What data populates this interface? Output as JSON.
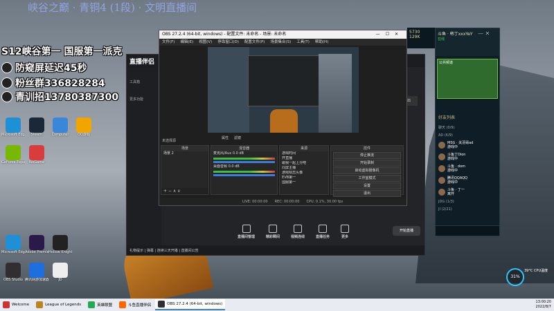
{
  "banner_text": "峡谷之巅 · 青铜4 (1段) · 文明直播间",
  "overlay": {
    "line1": "S12峡谷第一 国服第一派克",
    "line2": "防窥屏延迟45秒",
    "line3": "粉丝群336828284",
    "line4": "青训招13780387300"
  },
  "desktop_icons": [
    {
      "label": "Microsoft Edge",
      "color": "#1f8fd6"
    },
    {
      "label": "Steam",
      "color": "#1b2838"
    },
    {
      "label": "Computer",
      "color": "#3a86d9"
    },
    {
      "label": "QQ游戏",
      "color": "#f0a500"
    },
    {
      "label": "GeForce Experience",
      "color": "#76b900"
    },
    {
      "label": "WeGame",
      "color": "#d93c3c"
    },
    {
      "label": "Microsoft Edge",
      "color": "#1f8fd6"
    },
    {
      "label": "Adobe Premiere",
      "color": "#2a1a4a"
    },
    {
      "label": "Hollow Knight",
      "color": "#222"
    },
    {
      "label": "OBS Studio",
      "color": "#302e31"
    },
    {
      "label": "腾讯网游加速器",
      "color": "#1e6ee0"
    },
    {
      "label": "JD",
      "color": "#eee"
    }
  ],
  "obs": {
    "title": "OBS 27.2.4 (64-bit, windows) - 配置文件: 未命名 - 场景: 未命名",
    "menu": [
      "文件(F)",
      "编辑(E)",
      "视图(V)",
      "停靠窗口(D)",
      "配置文件(P)",
      "场景集合(S)",
      "工具(T)",
      "帮助(H)"
    ],
    "no_source": "未选择源",
    "controls": [
      "属性",
      "滤镜"
    ],
    "scenes_header": "场景",
    "scenes": [
      "场景 2"
    ],
    "mixer_header": "混音器",
    "mixer": [
      {
        "name": "麦克风/Aux",
        "level": "0.0 dB"
      },
      {
        "name": "桌面音频",
        "level": "0.0 dB"
      }
    ],
    "sources_header": "来源",
    "sources": [
      "游戏时间",
      "开直播",
      "跟我一起上分吧",
      "同屏主播",
      "游戏标志头像",
      "EVB第一",
      "国服第一"
    ],
    "controls_header": "控件",
    "control_buttons": [
      "停止推流",
      "开始录制",
      "启动虚拟摄像机",
      "工作室模式",
      "设置",
      "退出"
    ],
    "status": [
      "LIVE: 00:00:00",
      "REC: 00:00:00",
      "CPU: 0.1%, 30.00 fps"
    ]
  },
  "live_app": {
    "logo": "直播伴侣",
    "side_items": [
      "工具箱",
      "更多功能"
    ],
    "bottom_items": [
      "直播间管理",
      "精彩瞬间",
      "视频连线",
      "直播任务",
      "更多"
    ],
    "start_button": "开始直播",
    "right_button": "退出",
    "footer": "礼物提示  |  弹幕  |  连续三天开播  |  直播间公告"
  },
  "lol": {
    "rp": "5730",
    "be": "129K",
    "player_name": "斗鱼 · 韩丁xxxYeY",
    "player_status": "在线",
    "party_text": "公共频道",
    "friends_header": "好友列表",
    "groups": [
      "聊天 (0/9)",
      "AD (6/9)",
      "JDG (1/3)",
      "JI (2/21)"
    ],
    "friends": [
      {
        "name": "MSG · 关羽哥ad",
        "status": "游戏中"
      },
      {
        "name": "斗鱼丁Dion",
        "status": "游戏中"
      },
      {
        "name": "斗鱼 · dom",
        "status": "游戏中"
      },
      {
        "name": "腾讯QQAQQ",
        "status": "游戏中"
      },
      {
        "name": "斗鱼 · 丁一",
        "status": "离开"
      }
    ]
  },
  "system": {
    "battery": "31%",
    "cpu": "39°C CPU温度",
    "time": "13:00:20",
    "date": "2022/8/7"
  },
  "taskbar": [
    {
      "label": "Welcome",
      "color": "#c33",
      "active": false
    },
    {
      "label": "League of Legends",
      "color": "#b8861d",
      "active": false
    },
    {
      "label": "英雄联盟",
      "color": "#2a5",
      "active": false
    },
    {
      "label": "斗鱼直播伴侣",
      "color": "#f60",
      "active": false
    },
    {
      "label": "OBS 27.2.4 (64-bit, windows)",
      "color": "#302e31",
      "active": true
    }
  ]
}
